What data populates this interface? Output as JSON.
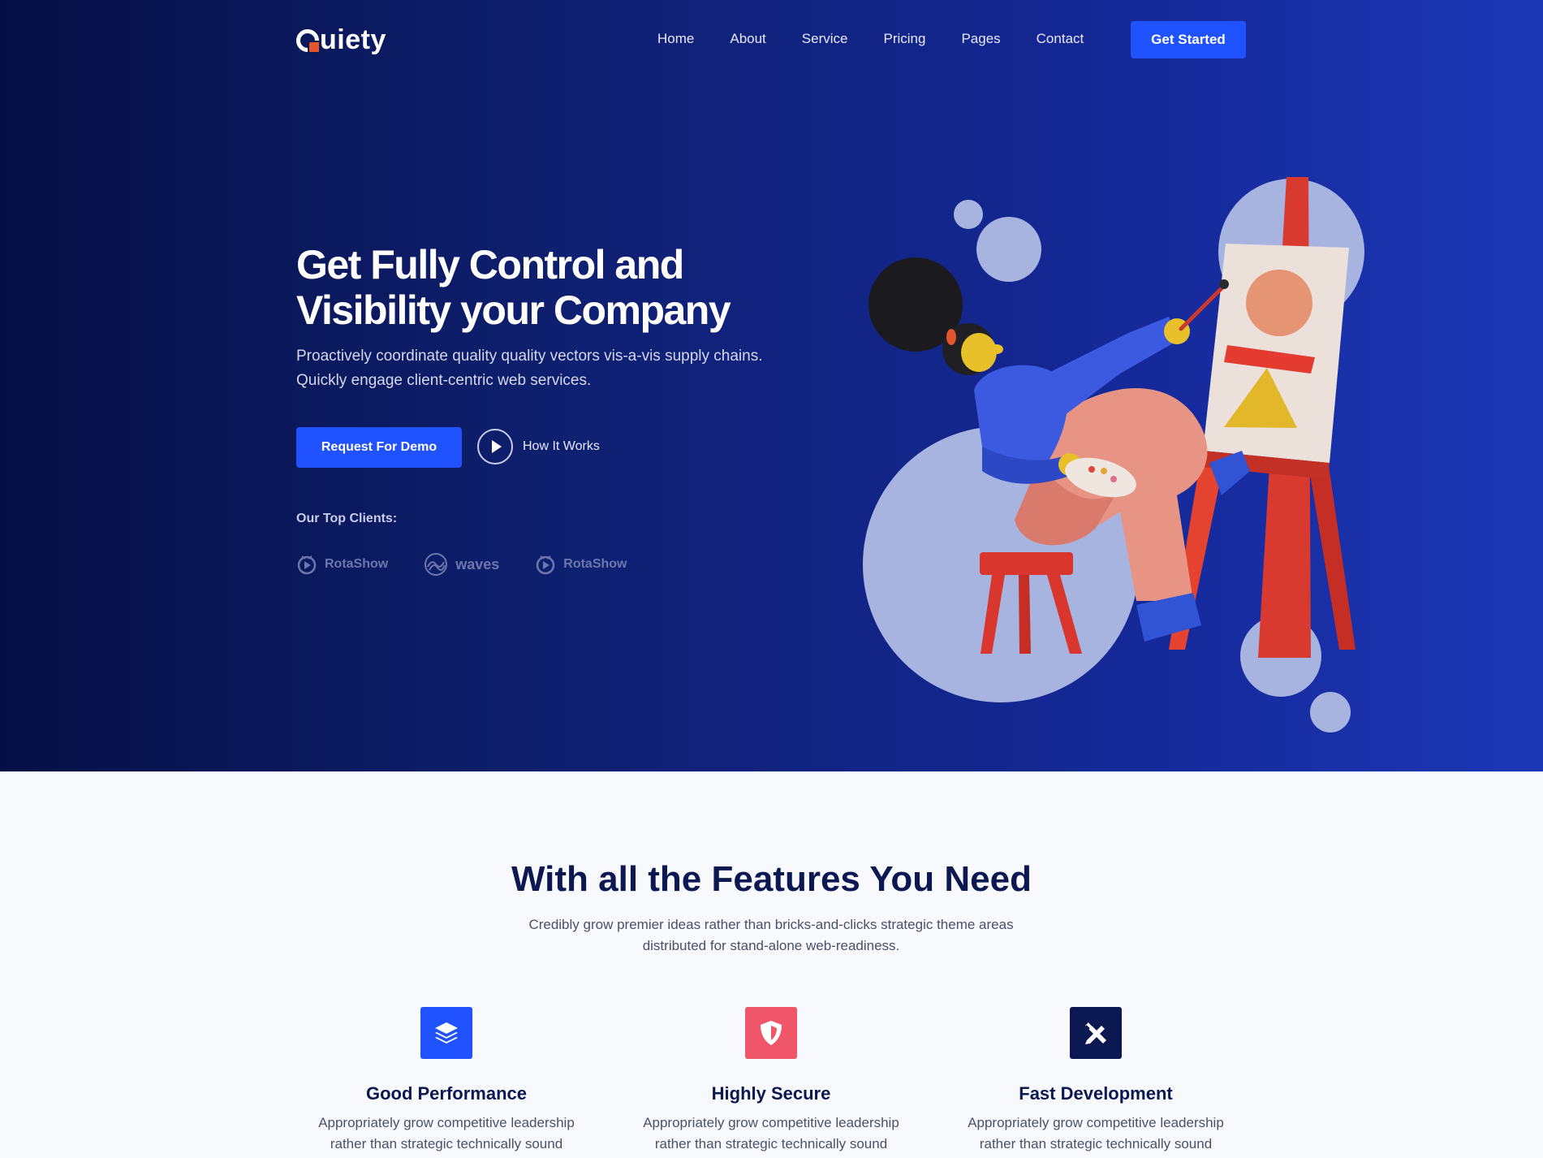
{
  "brand": {
    "name": "uiety",
    "full_name": "Quiety"
  },
  "nav": {
    "items": [
      "Home",
      "About",
      "Service",
      "Pricing",
      "Pages",
      "Contact"
    ],
    "cta": "Get Started"
  },
  "hero": {
    "title_line1": "Get Fully Control and",
    "title_line2": "Visibility your Company",
    "desc_line1": "Proactively coordinate quality quality vectors vis-a-vis supply chains.",
    "desc_line2": "Quickly engage client-centric web services.",
    "demo_button": "Request For Demo",
    "how_it_works": "How It Works",
    "clients_title": "Our Top Clients:",
    "clients": [
      "RotaShow",
      "waves",
      "RotaShow"
    ]
  },
  "features": {
    "title": "With all the Features You Need",
    "desc_line1": "Credibly grow premier ideas rather than bricks-and-clicks strategic theme areas",
    "desc_line2": "distributed for stand-alone web-readiness.",
    "cards": [
      {
        "title": "Good Performance",
        "text_line1": "Appropriately grow competitive leadership",
        "text_line2": "rather than strategic technically sound",
        "icon": "layers-icon",
        "color": "#2152ff"
      },
      {
        "title": "Highly Secure",
        "text_line1": "Appropriately grow competitive leadership",
        "text_line2": "rather than strategic technically sound",
        "icon": "shield-icon",
        "color": "#f0566a"
      },
      {
        "title": "Fast Development",
        "text_line1": "Appropriately grow competitive leadership",
        "text_line2": "rather than strategic technically sound",
        "icon": "tools-icon",
        "color": "#0b1851"
      }
    ]
  },
  "colors": {
    "primary": "#2152ff",
    "hero_dark": "#060f45",
    "hero_light": "#1c37b6",
    "heading": "#0b1851"
  }
}
